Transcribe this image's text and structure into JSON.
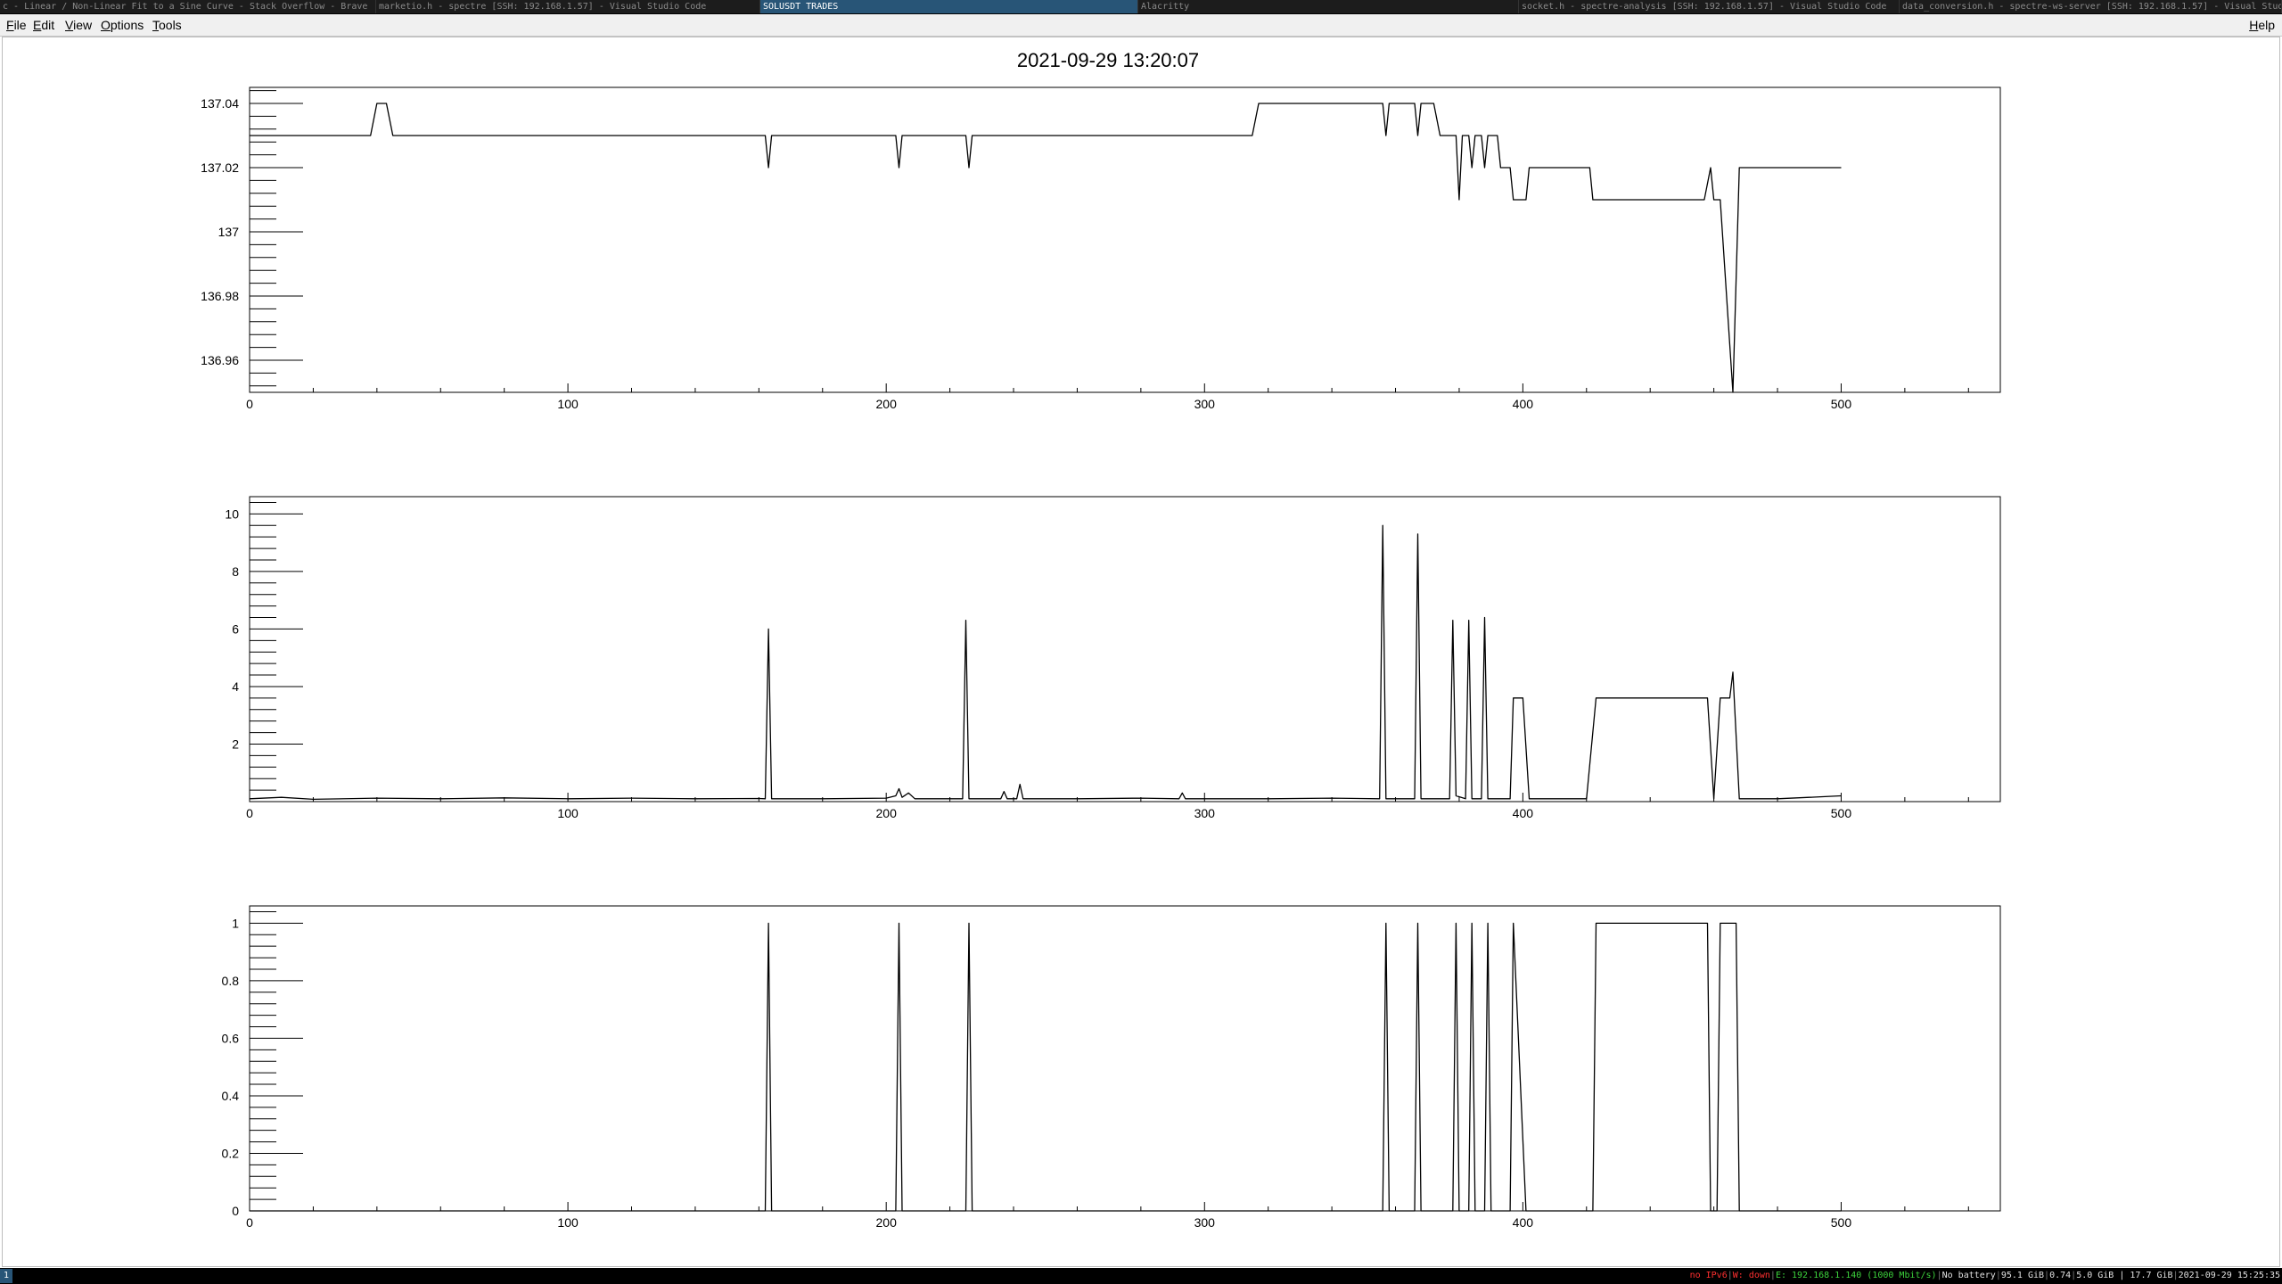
{
  "window_tabs": [
    {
      "title": "c - Linear / Non-Linear Fit to a Sine Curve - Stack Overflow - Brave",
      "active": false
    },
    {
      "title": "marketio.h - spectre [SSH: 192.168.1.57] - Visual Studio Code",
      "active": false
    },
    {
      "title": "SOLUSDT TRADES",
      "active": true
    },
    {
      "title": "Alacritty",
      "active": false
    },
    {
      "title": "socket.h - spectre-analysis [SSH: 192.168.1.57] - Visual Studio Code",
      "active": false
    },
    {
      "title": "data_conversion.h - spectre-ws-server [SSH: 192.168.1.57] - Visual Studio Code",
      "active": false
    }
  ],
  "menu": {
    "file": "File",
    "edit": "Edit",
    "view": "View",
    "options": "Options",
    "tools": "Tools",
    "help": "Help"
  },
  "canvas_title": "2021-09-29 13:20:07",
  "chart_data": [
    {
      "type": "line",
      "title": "2021-09-29 13:20:07",
      "xlim": [
        0,
        550
      ],
      "ylim": [
        136.95,
        137.045
      ],
      "x_ticks": [
        0,
        100,
        200,
        300,
        400,
        500
      ],
      "y_ticks": [
        136.96,
        136.98,
        137,
        137.02,
        137.04
      ],
      "y_tick_labels": [
        "136.96",
        "136.98",
        "137",
        "137.02",
        "137.04"
      ],
      "points": [
        [
          0,
          137.03
        ],
        [
          38,
          137.03
        ],
        [
          40,
          137.04
        ],
        [
          43,
          137.04
        ],
        [
          45,
          137.03
        ],
        [
          162,
          137.03
        ],
        [
          163,
          137.02
        ],
        [
          164,
          137.03
        ],
        [
          203,
          137.03
        ],
        [
          204,
          137.02
        ],
        [
          205,
          137.03
        ],
        [
          225,
          137.03
        ],
        [
          226,
          137.02
        ],
        [
          227,
          137.03
        ],
        [
          315,
          137.03
        ],
        [
          317,
          137.04
        ],
        [
          356,
          137.04
        ],
        [
          357,
          137.03
        ],
        [
          358,
          137.04
        ],
        [
          366,
          137.04
        ],
        [
          367,
          137.03
        ],
        [
          368,
          137.04
        ],
        [
          372,
          137.04
        ],
        [
          374,
          137.03
        ],
        [
          379,
          137.03
        ],
        [
          380,
          137.01
        ],
        [
          381,
          137.03
        ],
        [
          383,
          137.03
        ],
        [
          384,
          137.02
        ],
        [
          385,
          137.03
        ],
        [
          387,
          137.03
        ],
        [
          388,
          137.02
        ],
        [
          389,
          137.03
        ],
        [
          392,
          137.03
        ],
        [
          393,
          137.02
        ],
        [
          396,
          137.02
        ],
        [
          397,
          137.01
        ],
        [
          401,
          137.01
        ],
        [
          402,
          137.02
        ],
        [
          421,
          137.02
        ],
        [
          422,
          137.01
        ],
        [
          457,
          137.01
        ],
        [
          459,
          137.02
        ],
        [
          460,
          137.01
        ],
        [
          462,
          137.01
        ],
        [
          466,
          136.95
        ],
        [
          468,
          137.02
        ],
        [
          500,
          137.02
        ]
      ]
    },
    {
      "type": "line",
      "xlim": [
        0,
        550
      ],
      "ylim": [
        0,
        10.6
      ],
      "x_ticks": [
        0,
        100,
        200,
        300,
        400,
        500
      ],
      "y_ticks": [
        2,
        4,
        6,
        8,
        10
      ],
      "y_tick_labels": [
        "2",
        "4",
        "6",
        "8",
        "10"
      ],
      "points": [
        [
          0,
          0.1
        ],
        [
          10,
          0.15
        ],
        [
          20,
          0.08
        ],
        [
          40,
          0.12
        ],
        [
          60,
          0.1
        ],
        [
          80,
          0.13
        ],
        [
          100,
          0.1
        ],
        [
          120,
          0.12
        ],
        [
          140,
          0.1
        ],
        [
          160,
          0.11
        ],
        [
          162,
          0.1
        ],
        [
          163,
          6.0
        ],
        [
          164,
          0.1
        ],
        [
          180,
          0.1
        ],
        [
          200,
          0.12
        ],
        [
          203,
          0.2
        ],
        [
          204,
          0.45
        ],
        [
          205,
          0.15
        ],
        [
          207,
          0.3
        ],
        [
          209,
          0.1
        ],
        [
          224,
          0.1
        ],
        [
          225,
          6.3
        ],
        [
          226,
          0.1
        ],
        [
          236,
          0.1
        ],
        [
          237,
          0.35
        ],
        [
          238,
          0.1
        ],
        [
          241,
          0.1
        ],
        [
          242,
          0.6
        ],
        [
          243,
          0.1
        ],
        [
          260,
          0.1
        ],
        [
          280,
          0.12
        ],
        [
          292,
          0.1
        ],
        [
          293,
          0.3
        ],
        [
          294,
          0.1
        ],
        [
          320,
          0.1
        ],
        [
          340,
          0.12
        ],
        [
          355,
          0.1
        ],
        [
          356,
          9.6
        ],
        [
          357,
          0.1
        ],
        [
          366,
          0.1
        ],
        [
          367,
          9.3
        ],
        [
          368,
          0.1
        ],
        [
          377,
          0.1
        ],
        [
          378,
          6.3
        ],
        [
          379,
          0.2
        ],
        [
          382,
          0.1
        ],
        [
          383,
          6.3
        ],
        [
          384,
          0.1
        ],
        [
          387,
          0.1
        ],
        [
          388,
          6.4
        ],
        [
          389,
          0.1
        ],
        [
          396,
          0.1
        ],
        [
          397,
          3.6
        ],
        [
          400,
          3.6
        ],
        [
          402,
          0.1
        ],
        [
          420,
          0.1
        ],
        [
          423,
          3.6
        ],
        [
          458,
          3.6
        ],
        [
          460,
          0.1
        ],
        [
          462,
          3.6
        ],
        [
          465,
          3.6
        ],
        [
          466,
          4.5
        ],
        [
          468,
          0.1
        ],
        [
          480,
          0.1
        ],
        [
          490,
          0.15
        ],
        [
          500,
          0.2
        ]
      ]
    },
    {
      "type": "line",
      "xlim": [
        0,
        550
      ],
      "ylim": [
        0,
        1.06
      ],
      "x_ticks": [
        0,
        100,
        200,
        300,
        400,
        500
      ],
      "y_ticks": [
        0,
        0.2,
        0.4,
        0.6,
        0.8,
        1
      ],
      "y_tick_labels": [
        "0",
        "0.2",
        "0.4",
        "0.6",
        "0.8",
        "1"
      ],
      "points": [
        [
          0,
          0
        ],
        [
          162,
          0
        ],
        [
          163,
          1
        ],
        [
          164,
          0
        ],
        [
          203,
          0
        ],
        [
          204,
          1
        ],
        [
          205,
          0
        ],
        [
          225,
          0
        ],
        [
          226,
          1
        ],
        [
          227,
          0
        ],
        [
          356,
          0
        ],
        [
          357,
          1
        ],
        [
          358,
          0
        ],
        [
          366,
          0
        ],
        [
          367,
          1
        ],
        [
          368,
          0
        ],
        [
          378,
          0
        ],
        [
          379,
          1
        ],
        [
          380,
          0
        ],
        [
          383,
          0
        ],
        [
          384,
          1
        ],
        [
          385,
          0
        ],
        [
          388,
          0
        ],
        [
          389,
          1
        ],
        [
          390,
          0
        ],
        [
          396,
          0
        ],
        [
          397,
          1
        ],
        [
          401,
          0
        ],
        [
          422,
          0
        ],
        [
          423,
          1
        ],
        [
          458,
          1
        ],
        [
          459,
          0
        ],
        [
          461,
          0
        ],
        [
          462,
          1
        ],
        [
          467,
          1
        ],
        [
          468,
          0
        ],
        [
          500,
          0
        ]
      ]
    }
  ],
  "status_bar": {
    "workspace": "1",
    "ipv6": "no IPv6",
    "wifi": "W: down",
    "ethernet": "E: 192.168.1.140 (1000 Mbit/s)",
    "battery": "No battery",
    "disk": "95.1 GiB",
    "load": "0.74",
    "mem_used": "5.0 GiB",
    "mem_total": "17.7 GiB",
    "datetime": "2021-09-29 15:25:35"
  }
}
